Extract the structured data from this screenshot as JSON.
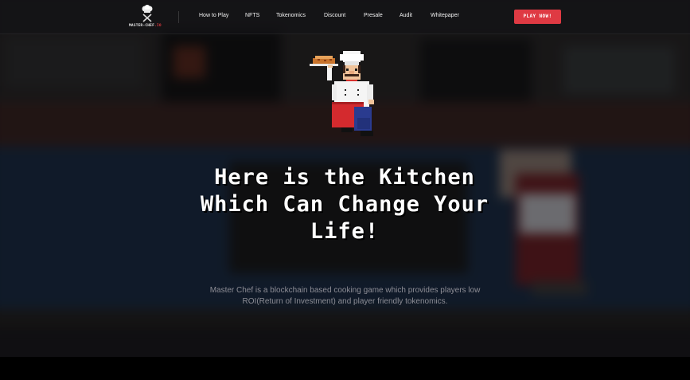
{
  "brand": {
    "name": "MASTER-CHEF",
    "tld": ".IO"
  },
  "nav": {
    "items": [
      {
        "label": "How to Play"
      },
      {
        "label": "NFTS"
      },
      {
        "label": "Tokenomics"
      },
      {
        "label": "Discount"
      },
      {
        "label": "Presale"
      },
      {
        "label": "Audit"
      },
      {
        "label": "Whitepaper"
      }
    ],
    "cta_label": "PLAY NOW!"
  },
  "hero": {
    "title": "Here is the Kitchen Which Can Change Your Life!",
    "description": "Master Chef is a blockchain based cooking game which provides players low ROI(Return of Investment) and player friendly tokenomics."
  },
  "colors": {
    "accent": "#df3a43",
    "background": "#1c1b1f",
    "text_muted": "#8d8d95"
  },
  "icons": {
    "logo": "chef-hat-crossed-utensils-icon",
    "hero": "pixel-chef-holding-pie"
  }
}
